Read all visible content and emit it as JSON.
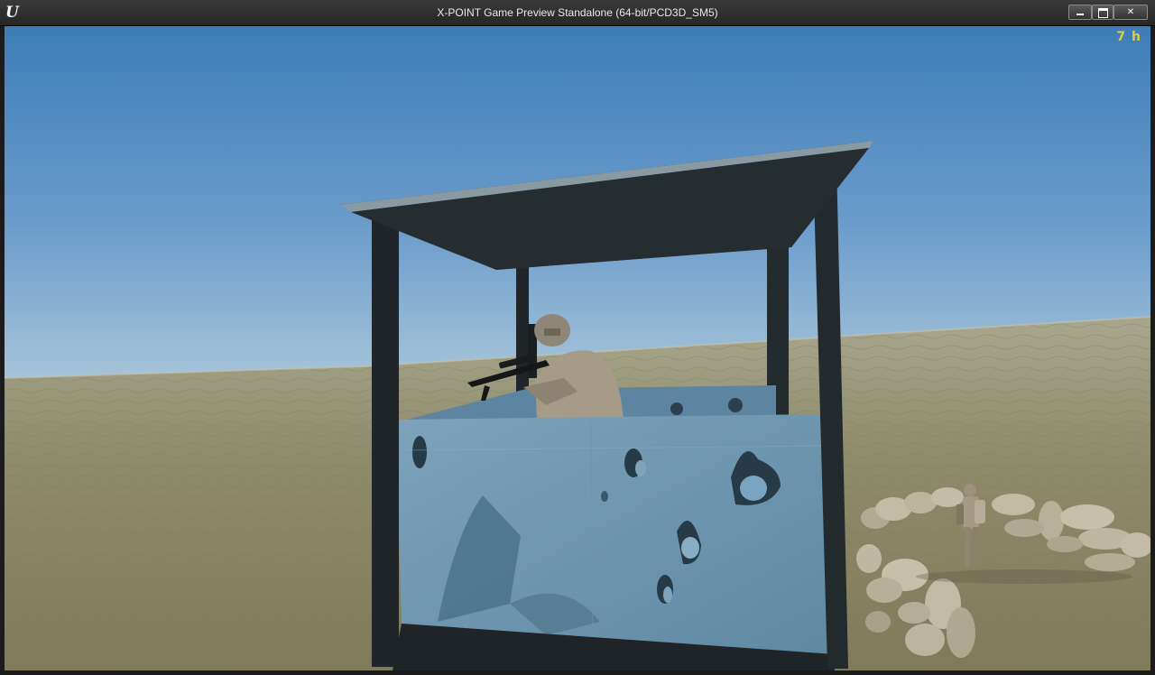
{
  "window": {
    "title": "X-POINT Game Preview Standalone (64-bit/PCD3D_SM5)",
    "logo_text": "U",
    "controls": {
      "minimize": "minimize-icon",
      "maximize": "maximize-icon",
      "close": "✕"
    }
  },
  "hud": {
    "stat_readout": "7 h"
  },
  "scene": {
    "colors": {
      "sky_top": "#3f7fba",
      "sky_horizon": "#b7cfde",
      "sand": "#8e8a6a",
      "tower_panel": "#6b95b0",
      "roof": "#2b3338"
    }
  }
}
